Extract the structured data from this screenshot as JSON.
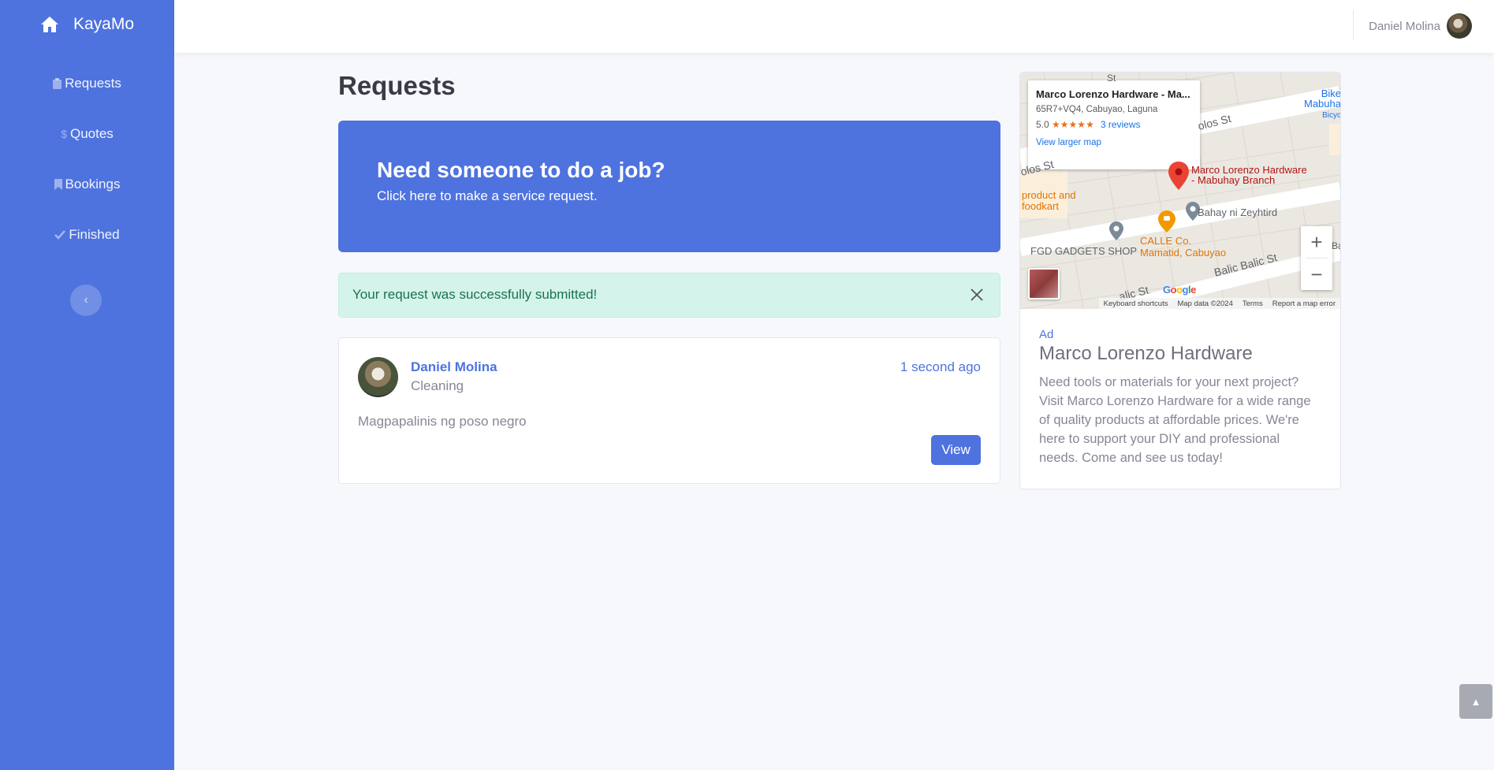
{
  "brand": {
    "name": "KayaMo",
    "icon": "home-icon"
  },
  "sidebar": {
    "items": [
      {
        "label": "Requests",
        "icon": "clipboard-icon"
      },
      {
        "label": "Quotes",
        "icon": "dollar-icon"
      },
      {
        "label": "Bookings",
        "icon": "bookmark-icon"
      },
      {
        "label": "Finished",
        "icon": "check-icon"
      }
    ],
    "toggle_icon": "chevron-left-icon"
  },
  "topbar": {
    "user_name": "Daniel Molina"
  },
  "main": {
    "title": "Requests",
    "cta": {
      "heading": "Need someone to do a job?",
      "subtext": "Click here to make a service request."
    },
    "alert": {
      "message": "Your request was successfully submitted!"
    },
    "request": {
      "user_name": "Daniel Molina",
      "category": "Cleaning",
      "time": "1 second ago",
      "description": "Magpapalinis ng poso negro",
      "view_label": "View"
    }
  },
  "ad": {
    "map": {
      "place_title": "Marco Lorenzo Hardware - Ma...",
      "address": "65R7+VQ4, Cabuyao, Laguna",
      "rating": "5.0",
      "stars": "★★★★★",
      "reviews": "3 reviews",
      "larger_map": "View larger map",
      "pin_label_line1": "Marco Lorenzo Hardware",
      "pin_label_line2": "- Mabuhay Branch",
      "poi_1": "Bahay ni Zeyhtird",
      "poi_2_line1": "CALLE Co.",
      "poi_2_line2": "Mamatid, Cabuyao",
      "poi_3": "FGD GADGETS SHOP",
      "poi_4_line1": "product and",
      "poi_4_line2": "foodkart",
      "poi_5_line1": "Bike",
      "poi_5_line2": "Mabuha",
      "poi_5_line3": "Bicyc",
      "street_1": "olos St",
      "street_2": "olos St",
      "street_3": "Balic Balic St",
      "street_4": "alic St",
      "street_5": "St",
      "street_6": "Ba",
      "zoom_in": "+",
      "zoom_out": "−",
      "attribution": [
        "Keyboard shortcuts",
        "Map data ©2024",
        "Terms",
        "Report a map error"
      ],
      "logo": "Google"
    },
    "tag": "Ad",
    "title": "Marco Lorenzo Hardware",
    "text": "Need tools or materials for your next project? Visit Marco Lorenzo Hardware for a wide range of quality products at affordable prices. We're here to support your DIY and professional needs. Come and see us today!"
  },
  "colors": {
    "primary": "#4e73df",
    "success_bg": "#d4f3ea",
    "success_text": "#1a7350",
    "page_bg": "#f7f8fc"
  }
}
